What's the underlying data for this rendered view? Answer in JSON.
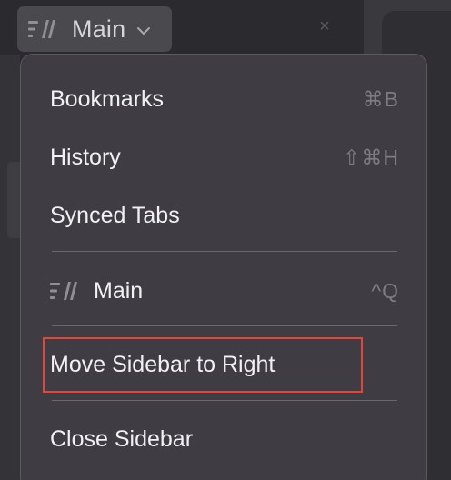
{
  "switcher": {
    "label": "Main"
  },
  "menu": {
    "items": [
      {
        "label": "Bookmarks",
        "shortcut": "⌘B"
      },
      {
        "label": "History",
        "shortcut": "⇧⌘H"
      },
      {
        "label": "Synced Tabs",
        "shortcut": ""
      },
      {
        "label": "Main",
        "shortcut": "^Q"
      },
      {
        "label": "Move Sidebar to Right",
        "shortcut": ""
      },
      {
        "label": "Close Sidebar",
        "shortcut": ""
      }
    ]
  },
  "colors": {
    "highlight": "#e0473a",
    "menu_bg": "#3f3d43",
    "text": "#f1f1f3",
    "shortcut": "#7e7c83"
  },
  "icons": {
    "sidebar_switcher": "sidebar-stripes-icon",
    "chevron": "chevron-down-icon",
    "close": "close-icon"
  }
}
